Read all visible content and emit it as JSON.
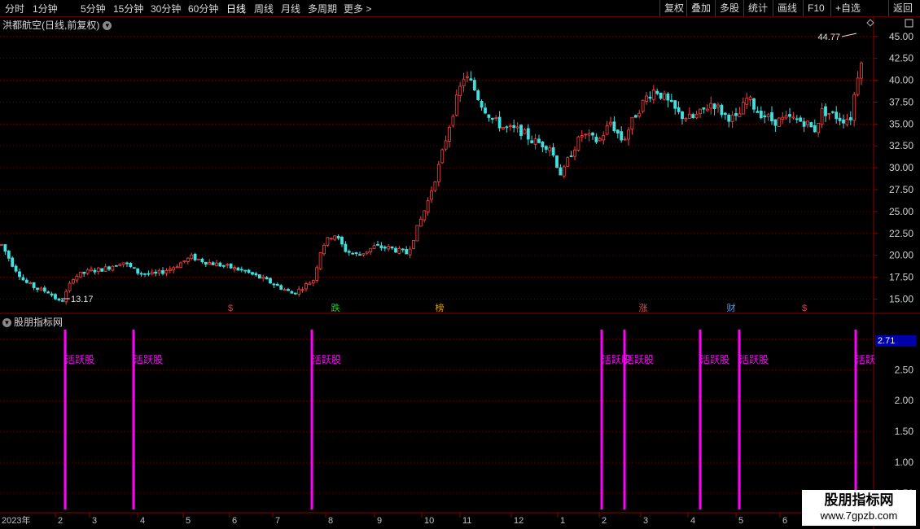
{
  "toolbar": {
    "periods": [
      "分时",
      "1分钟",
      "5分钟",
      "15分钟",
      "30分钟",
      "60分钟",
      "日线",
      "周线",
      "月线",
      "多周期",
      "更多 >"
    ],
    "active": "日线",
    "right_buttons": [
      "复权",
      "叠加",
      "多股",
      "统计",
      "画线",
      "F10",
      "+自选",
      "返回"
    ]
  },
  "stock": {
    "title": "洪都航空(日线,前复权)"
  },
  "labels": {
    "high": "44.77",
    "low": "13.17",
    "current_price": "2.71"
  },
  "indicator": {
    "title": "股朋指标网",
    "signal_label": "活跃股",
    "color": "#ff00ff"
  },
  "events": [
    {
      "label": "$",
      "color": "#e04040"
    },
    {
      "label": "跌",
      "color": "#20d020"
    },
    {
      "label": "榜",
      "color": "#e0a000"
    },
    {
      "label": "涨",
      "color": "#ff4040"
    },
    {
      "label": "财",
      "color": "#40a0ff"
    },
    {
      "label": "$",
      "color": "#e04040"
    }
  ],
  "x_axis": {
    "year": "2023年",
    "months": [
      "2",
      "3",
      "4",
      "5",
      "6",
      "7",
      "8",
      "9",
      "10",
      "11",
      "12",
      "1",
      "2",
      "3",
      "4",
      "5",
      "6"
    ]
  },
  "y_axis_price": [
    "45.00",
    "42.50",
    "40.00",
    "37.50",
    "35.00",
    "32.50",
    "30.00",
    "27.50",
    "25.00",
    "22.50",
    "20.00",
    "17.50",
    "15.00"
  ],
  "y_axis_indicator": [
    "3.00",
    "2.50",
    "2.00",
    "1.50",
    "1.00",
    "0.50"
  ],
  "chart_data": {
    "type": "candlestick",
    "title": "洪都航空(日线,前复权)",
    "y_range": [
      13.0,
      46.0
    ],
    "signals_count": 8,
    "price_path": [
      [
        2,
        21.2
      ],
      [
        15,
        19
      ],
      [
        30,
        17
      ],
      [
        45,
        16.2
      ],
      [
        60,
        15.8
      ],
      [
        75,
        14.5
      ],
      [
        90,
        17.5
      ],
      [
        110,
        18.2
      ],
      [
        130,
        18.5
      ],
      [
        150,
        19.3
      ],
      [
        170,
        18
      ],
      [
        190,
        17.8
      ],
      [
        210,
        18.5
      ],
      [
        235,
        19.8
      ],
      [
        255,
        19.2
      ],
      [
        275,
        18.8
      ],
      [
        300,
        18.2
      ],
      [
        330,
        17
      ],
      [
        360,
        15.6
      ],
      [
        385,
        17.2
      ],
      [
        395,
        21
      ],
      [
        410,
        22.5
      ],
      [
        425,
        20.5
      ],
      [
        440,
        20
      ],
      [
        460,
        21
      ],
      [
        480,
        20.8
      ],
      [
        500,
        20.2
      ],
      [
        510,
        22.5
      ],
      [
        525,
        26
      ],
      [
        540,
        30.5
      ],
      [
        555,
        36
      ],
      [
        570,
        40.5
      ],
      [
        580,
        39.5
      ],
      [
        590,
        37.5
      ],
      [
        605,
        35.5
      ],
      [
        620,
        34.5
      ],
      [
        640,
        34.2
      ],
      [
        655,
        33
      ],
      [
        675,
        32.5
      ],
      [
        690,
        29
      ],
      [
        700,
        31.5
      ],
      [
        715,
        33.8
      ],
      [
        735,
        33
      ],
      [
        750,
        35.2
      ],
      [
        765,
        33
      ],
      [
        780,
        36
      ],
      [
        795,
        38.2
      ],
      [
        805,
        39
      ],
      [
        820,
        37.5
      ],
      [
        835,
        36
      ],
      [
        850,
        35.6
      ],
      [
        860,
        36.2
      ],
      [
        875,
        37.5
      ],
      [
        890,
        36
      ],
      [
        905,
        35.5
      ],
      [
        918,
        38
      ],
      [
        930,
        36.5
      ],
      [
        950,
        35.3
      ],
      [
        970,
        35.6
      ],
      [
        990,
        35.2
      ],
      [
        1000,
        34.2
      ],
      [
        1010,
        36.5
      ],
      [
        1020,
        36.2
      ],
      [
        1035,
        35.5
      ],
      [
        1045,
        35.8
      ],
      [
        1052,
        40
      ],
      [
        1060,
        43.5
      ]
    ]
  },
  "colors": {
    "up": "#ff4040",
    "down": "#40e0e0",
    "grid": "#6a0000",
    "axis": "#8a0000",
    "text": "#d0d0d0",
    "signal": "#ff00ff"
  }
}
